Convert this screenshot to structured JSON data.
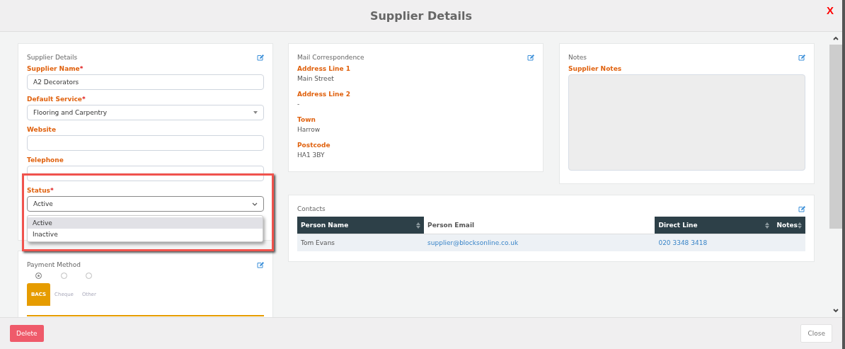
{
  "modal": {
    "title": "Supplier Details",
    "close": "X"
  },
  "supplier_details": {
    "title": "Supplier Details",
    "fields": [
      {
        "label": "Supplier Name",
        "required_mark": "*",
        "kind": "input",
        "value": "A2 Decorators"
      },
      {
        "label": "Default Service",
        "required_mark": "*",
        "kind": "select",
        "value": "Flooring and Carpentry"
      },
      {
        "label": "Website",
        "kind": "input"
      },
      {
        "label": "Telephone",
        "kind": "input"
      }
    ],
    "status": {
      "label": "Status",
      "required_mark": "*",
      "value": "Active",
      "expanded": true,
      "options": [
        {
          "label": "Active",
          "selected": true
        },
        {
          "label": "Inactive",
          "selected": false
        }
      ]
    }
  },
  "payment_method": {
    "title": "Payment Method",
    "options": [
      {
        "label": "BACS",
        "selected": true
      },
      {
        "label": "Cheque",
        "selected": false
      },
      {
        "label": "Other",
        "selected": false
      }
    ]
  },
  "mail_correspondence": {
    "title": "Mail Correspondence",
    "fields": [
      {
        "label": "Address Line 1",
        "value": "Main Street"
      },
      {
        "label": "Address Line 2",
        "value": "-"
      },
      {
        "label": "Town",
        "value": "Harrow"
      },
      {
        "label": "Postcode",
        "value": "HA1 3BY"
      }
    ]
  },
  "notes": {
    "title": "Notes",
    "label": "Supplier Notes"
  },
  "contacts": {
    "title": "Contacts",
    "columns": [
      {
        "label": "Person Name",
        "highlighted": false
      },
      {
        "label": "Person Email",
        "highlighted": true
      },
      {
        "label": "Direct Line",
        "highlighted": false
      },
      {
        "label": "Notes",
        "highlighted": false
      }
    ],
    "rows": [
      [
        {
          "kind": "text",
          "text": "Tom Evans"
        },
        {
          "kind": "link",
          "text": "supplier@blocksonline.co.uk"
        },
        {
          "kind": "link",
          "text": "020 3348 3418"
        },
        {
          "kind": "empty"
        }
      ]
    ]
  },
  "footer": {
    "delete": "Delete",
    "close": "Close"
  }
}
